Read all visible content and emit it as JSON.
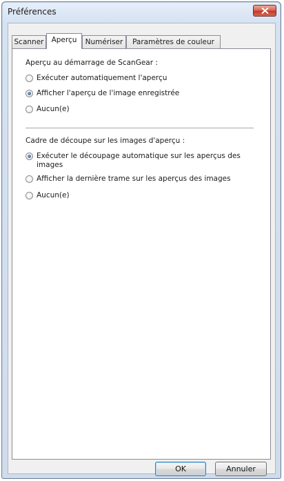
{
  "window": {
    "title": "Préférences"
  },
  "tabs": [
    {
      "label": "Scanner"
    },
    {
      "label": "Aperçu"
    },
    {
      "label": "Numériser"
    },
    {
      "label": "Paramètres de couleur"
    }
  ],
  "preview_startup": {
    "label": "Aperçu au démarrage de ScanGear :",
    "options": [
      {
        "label": "Exécuter automatiquement l'aperçu",
        "checked": false
      },
      {
        "label": "Afficher l'aperçu de l'image enregistrée",
        "checked": true
      },
      {
        "label": "Aucun(e)",
        "checked": false
      }
    ]
  },
  "crop_frame": {
    "label": "Cadre de découpe sur les images d'aperçu :",
    "options": [
      {
        "label": "Exécuter le découpage automatique sur les aperçus des images",
        "checked": true
      },
      {
        "label": "Afficher la dernière trame sur les aperçus des images",
        "checked": false
      },
      {
        "label": "Aucun(e)",
        "checked": false
      }
    ]
  },
  "buttons": {
    "ok_label": "OK",
    "cancel_label": "Annuler"
  }
}
